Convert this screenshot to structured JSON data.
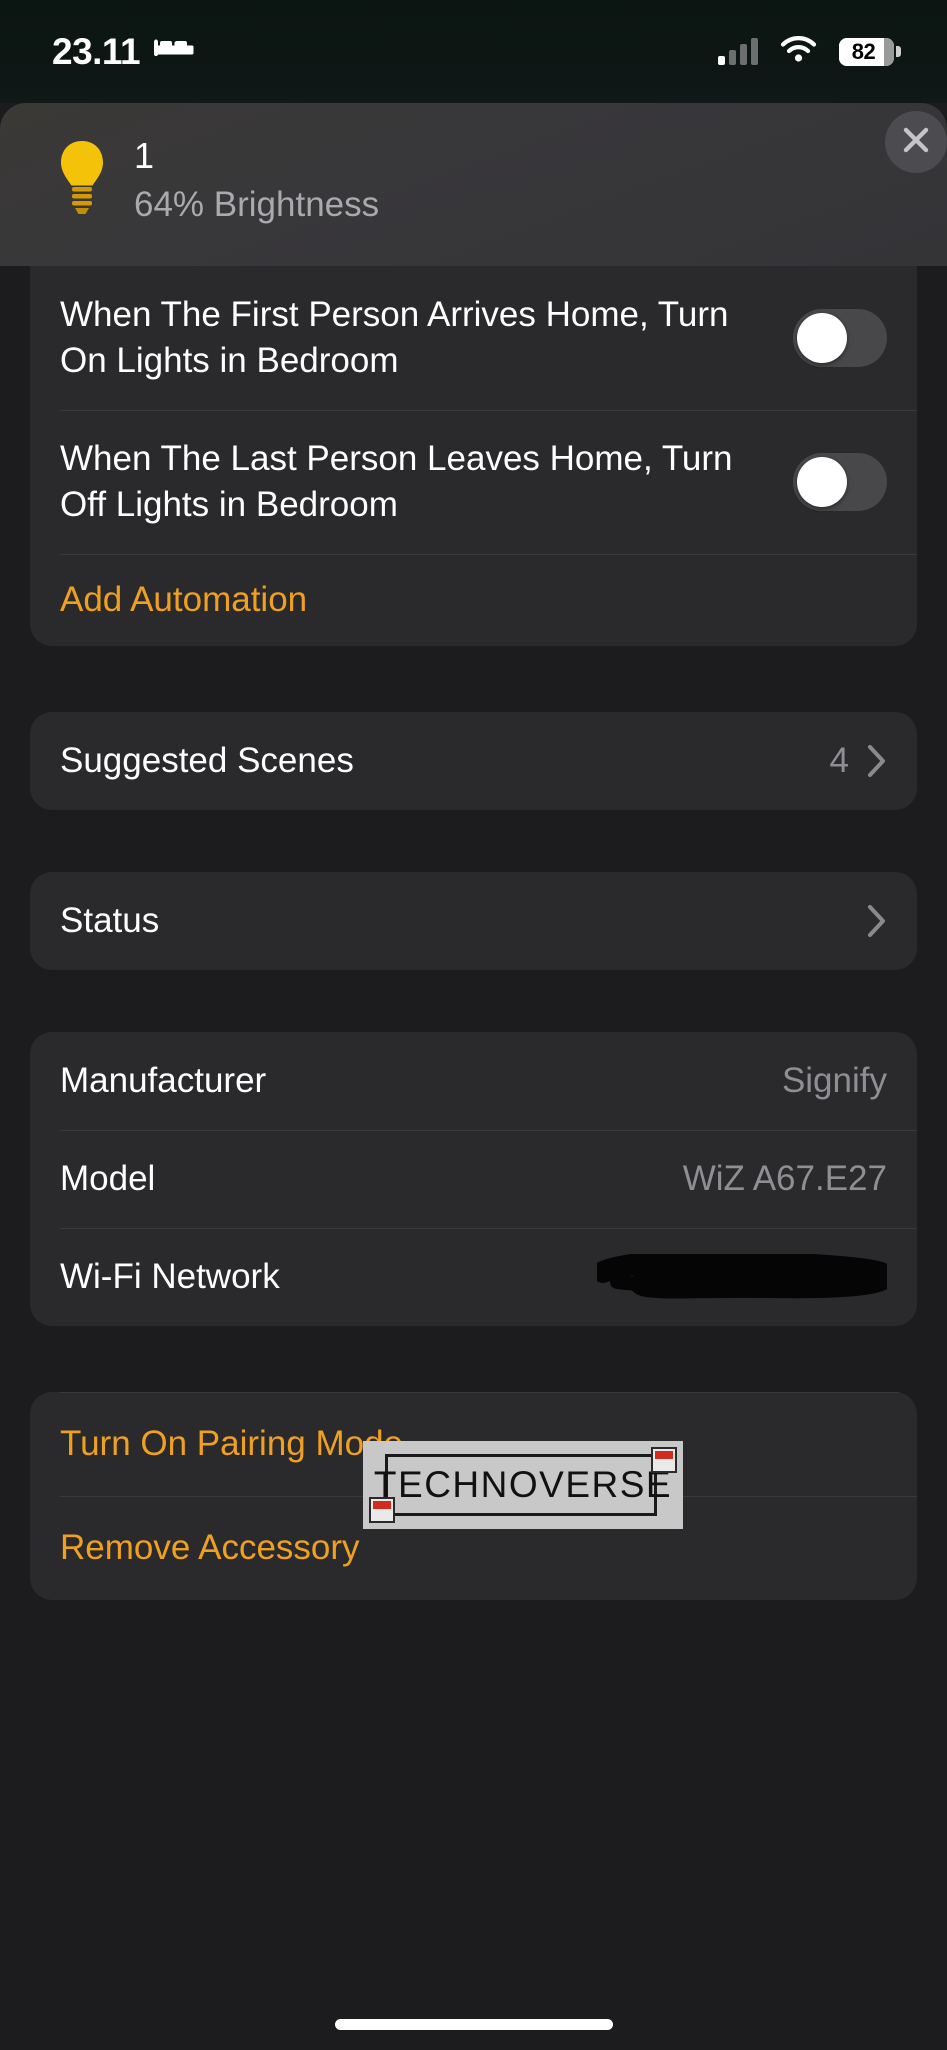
{
  "status_bar": {
    "time": "23.11",
    "focus_icon": "bed-icon",
    "cellular_icon": "cellular-signal-icon",
    "cellular_bars_filled": 1,
    "cellular_bars_total": 4,
    "wifi_icon": "wifi-icon",
    "battery_icon": "battery-icon",
    "battery_percent": "82",
    "battery_level": 82
  },
  "header": {
    "accessory_icon": "lightbulb-icon",
    "accessory_icon_color": "#F5C20A",
    "title": "1",
    "subtitle": "64% Brightness",
    "brightness_percent": 64,
    "close_icon": "close-icon"
  },
  "automations": {
    "items": [
      {
        "text": "When The First Person Arrives Home, Turn On Lights in Bedroom",
        "enabled": false
      },
      {
        "text": "When The Last Person Leaves Home, Turn Off Lights in Bedroom",
        "enabled": false
      }
    ],
    "add_label": "Add Automation"
  },
  "suggested_scenes": {
    "label": "Suggested Scenes",
    "count": "4",
    "chevron_icon": "chevron-right-icon"
  },
  "status_section": {
    "label": "Status",
    "chevron_icon": "chevron-right-icon"
  },
  "details": {
    "rows": [
      {
        "label": "Manufacturer",
        "value": "Signify"
      },
      {
        "label": "Model",
        "value": "WiZ A67.E27"
      },
      {
        "label": "Wi-Fi Network",
        "value": "",
        "redacted": true
      }
    ]
  },
  "actions": {
    "pairing_label": "Turn On Pairing Mode",
    "remove_label": "Remove Accessory"
  },
  "watermark": {
    "text": "TECHNOVERSE"
  },
  "colors": {
    "accent_orange": "#F0A021",
    "card_background": "#2a2a2c",
    "page_background": "#1c1c1e",
    "secondary_text": "#8e8e93"
  }
}
